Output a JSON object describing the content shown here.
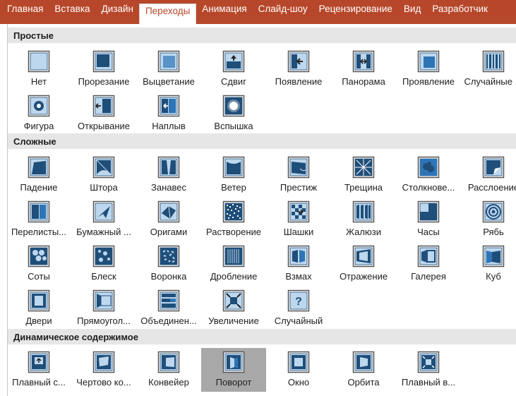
{
  "ribbon": {
    "tabs": [
      {
        "label": "Главная",
        "active": false
      },
      {
        "label": "Вставка",
        "active": false
      },
      {
        "label": "Дизайн",
        "active": false
      },
      {
        "label": "Переходы",
        "active": true
      },
      {
        "label": "Анимация",
        "active": false
      },
      {
        "label": "Слайд-шоу",
        "active": false
      },
      {
        "label": "Рецензирование",
        "active": false
      },
      {
        "label": "Вид",
        "active": false
      },
      {
        "label": "Разработчик",
        "active": false
      }
    ],
    "colors": {
      "tab_bar": "#b7472a",
      "active_tab_text": "#b7472a"
    }
  },
  "gallery": {
    "sections": [
      {
        "title": "Простые",
        "items": [
          {
            "label": "Нет",
            "icon": "none-transition-icon"
          },
          {
            "label": "Прорезание",
            "icon": "cut-transition-icon"
          },
          {
            "label": "Выцветание",
            "icon": "fade-transition-icon"
          },
          {
            "label": "Сдвиг",
            "icon": "push-transition-icon"
          },
          {
            "label": "Появление",
            "icon": "wipe-transition-icon"
          },
          {
            "label": "Панорама",
            "icon": "split-transition-icon"
          },
          {
            "label": "Проявление",
            "icon": "reveal-transition-icon"
          },
          {
            "label": "Случайные ...",
            "icon": "random-bars-transition-icon"
          },
          {
            "label": "Фигура",
            "icon": "shape-transition-icon"
          },
          {
            "label": "Открывание",
            "icon": "uncover-transition-icon"
          },
          {
            "label": "Наплыв",
            "icon": "cover-transition-icon"
          },
          {
            "label": "Вспышка",
            "icon": "flash-transition-icon"
          }
        ]
      },
      {
        "title": "Сложные",
        "items": [
          {
            "label": "Падение",
            "icon": "fall-over-transition-icon"
          },
          {
            "label": "Штора",
            "icon": "drape-transition-icon"
          },
          {
            "label": "Занавес",
            "icon": "curtains-transition-icon"
          },
          {
            "label": "Ветер",
            "icon": "wind-transition-icon"
          },
          {
            "label": "Престиж",
            "icon": "prestige-transition-icon"
          },
          {
            "label": "Трещина",
            "icon": "fracture-transition-icon"
          },
          {
            "label": "Столкнове...",
            "icon": "crush-transition-icon"
          },
          {
            "label": "Расслоение",
            "icon": "peel-off-transition-icon"
          },
          {
            "label": "Перелисты...",
            "icon": "page-curl-transition-icon"
          },
          {
            "label": "Бумажный ...",
            "icon": "airplane-transition-icon"
          },
          {
            "label": "Оригами",
            "icon": "origami-transition-icon"
          },
          {
            "label": "Растворение",
            "icon": "dissolve-transition-icon"
          },
          {
            "label": "Шашки",
            "icon": "checkerboard-transition-icon"
          },
          {
            "label": "Жалюзи",
            "icon": "blinds-transition-icon"
          },
          {
            "label": "Часы",
            "icon": "clock-transition-icon"
          },
          {
            "label": "Рябь",
            "icon": "ripple-transition-icon"
          },
          {
            "label": "Соты",
            "icon": "honeycomb-transition-icon"
          },
          {
            "label": "Блеск",
            "icon": "glitter-transition-icon"
          },
          {
            "label": "Воронка",
            "icon": "vortex-transition-icon"
          },
          {
            "label": "Дробление",
            "icon": "shred-transition-icon"
          },
          {
            "label": "Взмах",
            "icon": "switch-transition-icon"
          },
          {
            "label": "Отражение",
            "icon": "flip-transition-icon"
          },
          {
            "label": "Галерея",
            "icon": "gallery-transition-icon"
          },
          {
            "label": "Куб",
            "icon": "cube-transition-icon"
          },
          {
            "label": "Двери",
            "icon": "doors-transition-icon"
          },
          {
            "label": "Прямоугол...",
            "icon": "box-transition-icon"
          },
          {
            "label": "Объединен...",
            "icon": "comb-transition-icon"
          },
          {
            "label": "Увеличение",
            "icon": "zoom-transition-icon"
          },
          {
            "label": "Случайный",
            "icon": "random-transition-icon"
          }
        ]
      },
      {
        "title": "Динамическое содержимое",
        "items": [
          {
            "label": "Плавный с...",
            "icon": "pan-transition-icon"
          },
          {
            "label": "Чертово ко...",
            "icon": "ferris-wheel-transition-icon"
          },
          {
            "label": "Конвейер",
            "icon": "conveyor-transition-icon"
          },
          {
            "label": "Поворот",
            "icon": "rotate-transition-icon",
            "selected": true
          },
          {
            "label": "Окно",
            "icon": "window-transition-icon"
          },
          {
            "label": "Орбита",
            "icon": "orbit-transition-icon"
          },
          {
            "label": "Плавный в...",
            "icon": "fly-through-transition-icon"
          }
        ]
      }
    ],
    "colors": {
      "icon_dark": "#1f4e79",
      "icon_mid": "#2e75b6",
      "icon_light": "#bdd7ee",
      "section_header_bg": "#e6e6e6",
      "selected_bg": "#a8a8a8"
    }
  }
}
